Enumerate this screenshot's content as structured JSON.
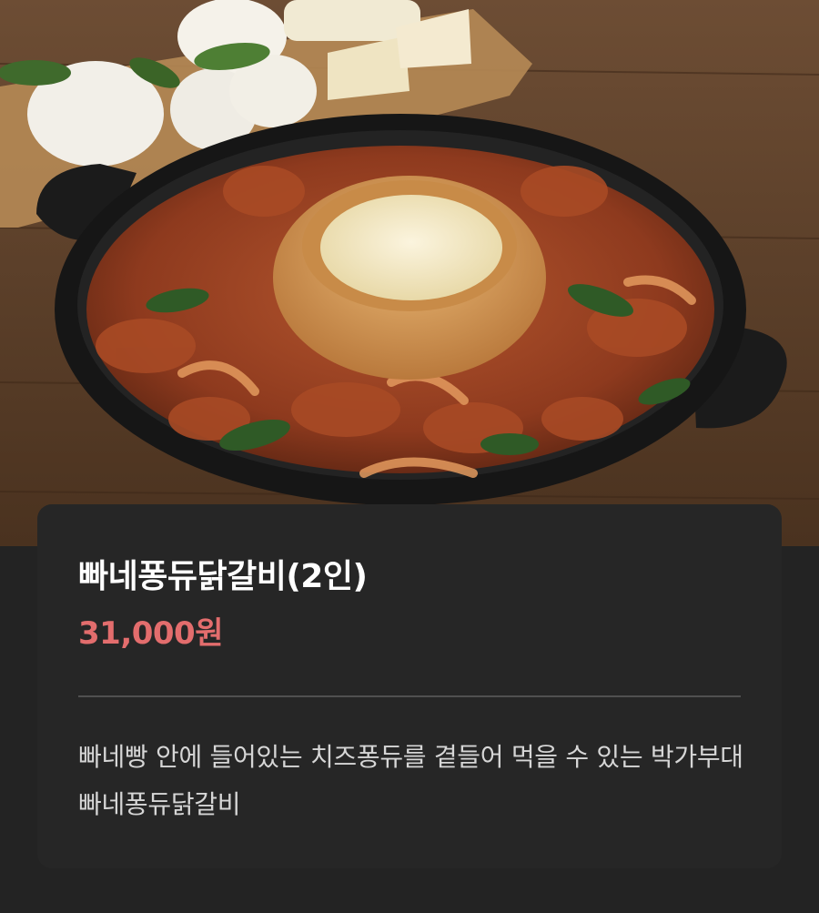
{
  "menu": {
    "title": "빠네퐁듀닭갈비(2인)",
    "price": "31,000원",
    "description": "빠네빵 안에 들어있는 치즈퐁듀를 곁들어 먹을 수 있는 박가부대 빠네퐁듀닭갈비"
  },
  "colors": {
    "background": "#232323",
    "card": "#262626",
    "title": "#ffffff",
    "price": "#e36d6d",
    "description": "#d6d6d6",
    "divider": "#505050"
  },
  "image": {
    "alt": "빠네퐁듀닭갈비(2인)"
  }
}
